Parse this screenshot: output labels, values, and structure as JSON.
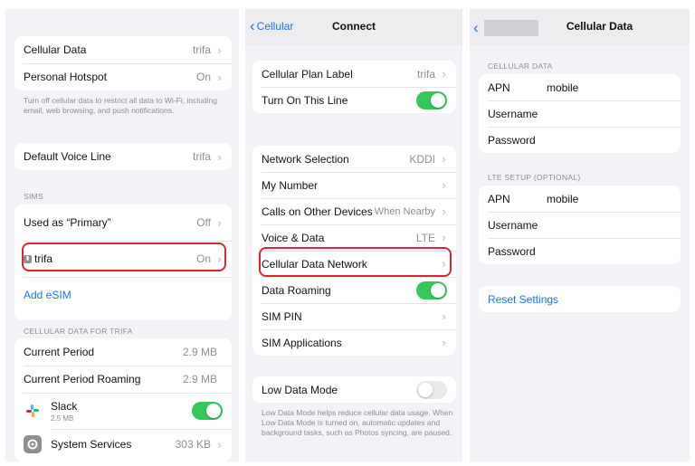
{
  "panel1": {
    "card_top": [
      {
        "label": "Cellular Data",
        "value": "trifa"
      },
      {
        "label": "Personal Hotspot",
        "value": "On"
      }
    ],
    "footer_text": "Turn off cellular data to restrict all data to Wi-Fi, including email, web browsing, and push notifications.",
    "default_voice": {
      "label": "Default Voice Line",
      "value": "trifa"
    },
    "sims_header": "SIMs",
    "primary": {
      "label": "Used as “Primary”",
      "value": "Off"
    },
    "sim_trifa": {
      "label": "trifa",
      "value": "On"
    },
    "add_esim": "Add eSIM",
    "data_header": "CELLULAR DATA FOR TRIFA",
    "current_period": {
      "label": "Current Period",
      "value": "2.9 MB"
    },
    "current_roaming": {
      "label": "Current Period Roaming",
      "value": "2.9 MB"
    },
    "slack": {
      "label": "Slack",
      "sub": "2.5 MB"
    },
    "system_services": {
      "label": "System Services",
      "value": "303 KB"
    }
  },
  "panel2": {
    "back_label": "Cellular",
    "title": "Connect",
    "plan_label": {
      "label": "Cellular Plan Label",
      "value": "trifa"
    },
    "turn_on_line": {
      "label": "Turn On This Line"
    },
    "network_selection": {
      "label": "Network Selection",
      "value": "KDDI"
    },
    "my_number": {
      "label": "My Number"
    },
    "calls_other": {
      "label": "Calls on Other Devices",
      "value": "When Nearby"
    },
    "voice_data": {
      "label": "Voice & Data",
      "value": "LTE"
    },
    "cellular_data_network": {
      "label": "Cellular Data Network"
    },
    "data_roaming": {
      "label": "Data Roaming"
    },
    "sim_pin": {
      "label": "SIM PIN"
    },
    "sim_apps": {
      "label": "SIM Applications"
    },
    "low_data": {
      "label": "Low Data Mode"
    },
    "low_data_footer": "Low Data Mode helps reduce cellular data usage. When Low Data Mode is turned on, automatic updates and background tasks, such as Photos syncing, are paused."
  },
  "panel3": {
    "title": "Cellular Data",
    "cellular_header": "CELLULAR DATA",
    "apn_label": "APN",
    "apn_value": "mobile",
    "username_label": "Username",
    "password_label": "Password",
    "lte_header": "LTE SETUP (OPTIONAL)",
    "lte_apn_label": "APN",
    "lte_apn_value": "mobile",
    "lte_username_label": "Username",
    "lte_password_label": "Password",
    "reset": "Reset Settings"
  },
  "toggles": {
    "turn_on_line": true,
    "data_roaming": true,
    "slack": true,
    "low_data": false
  },
  "colors": {
    "accent": "#1a73e8",
    "toggle_on": "#34c759",
    "highlight": "#d9262f",
    "background": "#f2f2f7"
  }
}
